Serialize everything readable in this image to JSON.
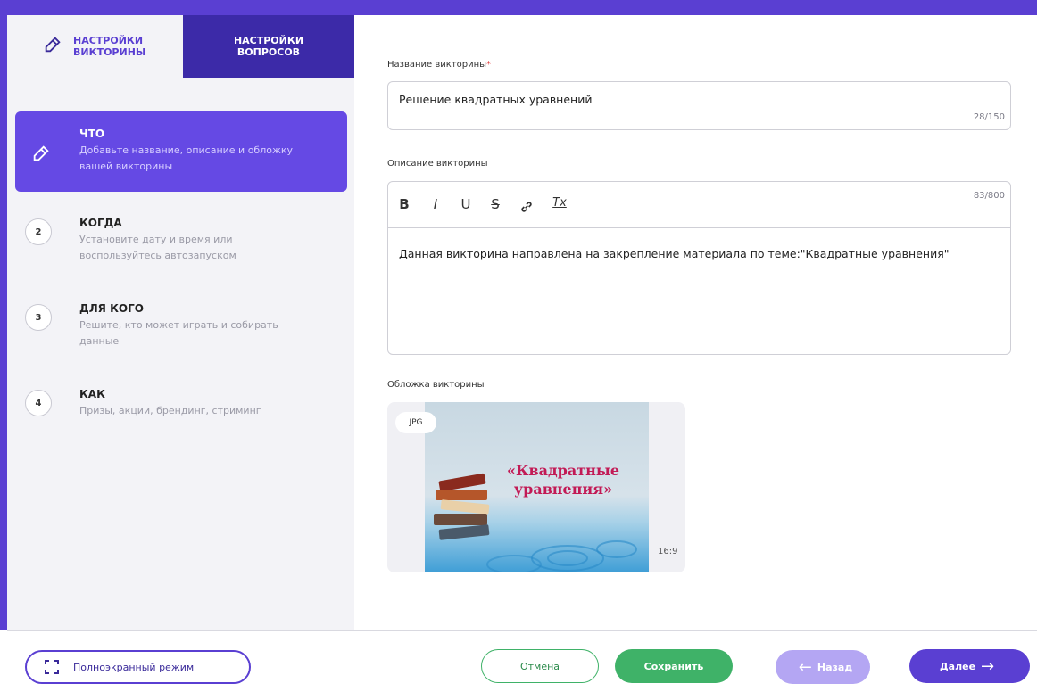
{
  "colors": {
    "primary": "#5a3fd2",
    "primary_dark": "#3c2aa8",
    "green": "#3fb268",
    "required": "#e03c3c"
  },
  "tabs": [
    {
      "label_line1": "НАСТРОЙКИ",
      "label_line2": "ВИКТОРИНЫ",
      "icon": "pencil-icon",
      "active": true
    },
    {
      "label_line1": "НАСТРОЙКИ",
      "label_line2": "ВОПРОСОВ",
      "active": false
    }
  ],
  "steps": [
    {
      "title": "ЧТО",
      "desc": "Добавьте название, описание и обложку вашей викторины",
      "icon": "pencil-icon",
      "active": true
    },
    {
      "number": "2",
      "title": "КОГДА",
      "desc": "Установите дату и время или воспользуйтесь автозапуском"
    },
    {
      "number": "3",
      "title": "ДЛЯ КОГО",
      "desc": "Решите, кто может играть и собирать данные"
    },
    {
      "number": "4",
      "title": "КАК",
      "desc": "Призы, акции, брендинг, стриминг"
    }
  ],
  "form": {
    "name_label": "Название викторины",
    "name_required_mark": "*",
    "name_value": "Решение квадратных уравнений",
    "name_counter": "28/150",
    "desc_label": "Описание викторины",
    "desc_counter": "83/800",
    "toolbar": {
      "bold": "B",
      "italic": "I",
      "underline": "U",
      "strike": "S",
      "link_icon": "link-icon",
      "clear_format": "Tx"
    },
    "desc_value": "Данная викторина направлена на закрепление материала по теме:\"Квадратные уравнения\"",
    "cover_label": "Обложка викторины",
    "cover_badge": "JPG",
    "cover_title": "«Квадратные уравнения»",
    "cover_ratio": "16:9"
  },
  "footer": {
    "fullscreen_label": "Полноэкранный режим",
    "fullscreen_icon": "fullscreen-icon",
    "cancel_label": "Отмена",
    "save_label": "Сохранить",
    "back_label": "Назад",
    "next_label": "Далее",
    "back_icon": "arrow-left-icon",
    "next_icon": "arrow-right-icon"
  }
}
